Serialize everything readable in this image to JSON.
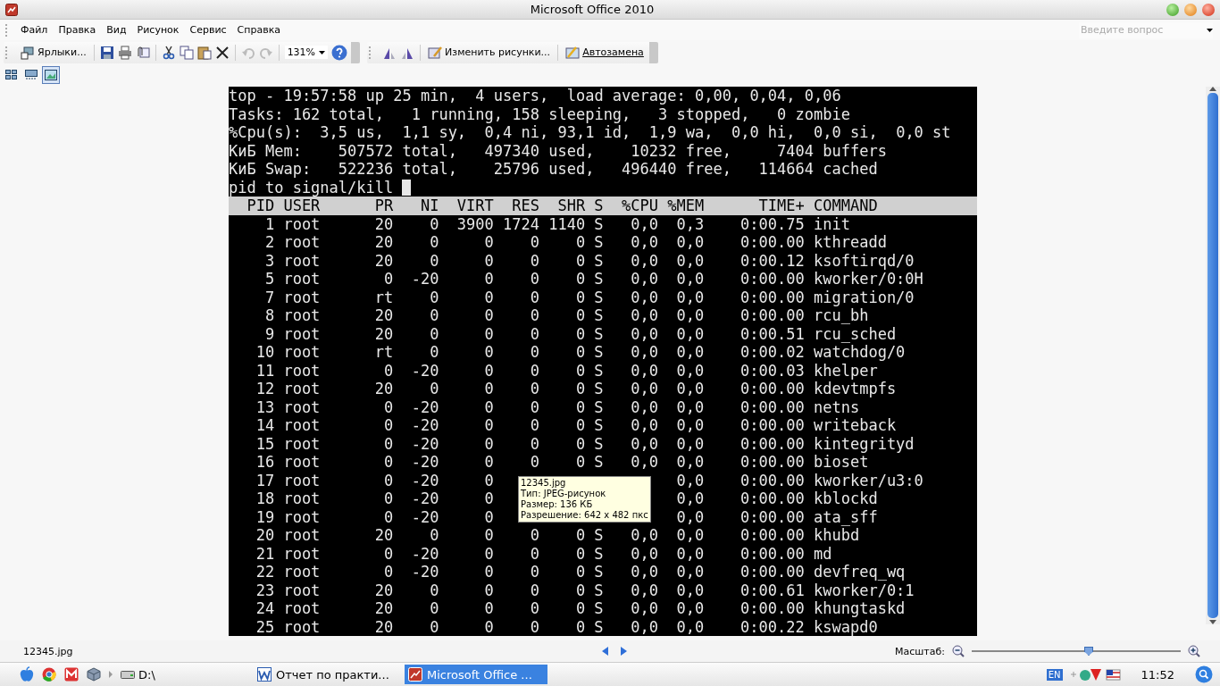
{
  "window": {
    "title": "Microsoft Office 2010"
  },
  "menu": [
    "Файл",
    "Правка",
    "Вид",
    "Рисунок",
    "Сервис",
    "Справка"
  ],
  "help_search": {
    "placeholder": "Введите вопрос"
  },
  "toolbar": {
    "shortcuts": "Ярлыки...",
    "zoom": "131%",
    "edit_pictures": "Изменить рисунки...",
    "autocorrect": "Автозамена"
  },
  "view_buttons": [
    {
      "kind": "thumbnails",
      "selected": false
    },
    {
      "kind": "filmstrip",
      "selected": false
    },
    {
      "kind": "single",
      "selected": true
    }
  ],
  "terminal": {
    "summary": [
      "top - 19:57:58 up 25 min,  4 users,  load average: 0,00, 0,04, 0,06",
      "Tasks: 162 total,   1 running, 158 sleeping,   3 stopped,   0 zombie",
      "%Cpu(s):  3,5 us,  1,1 sy,  0,4 ni, 93,1 id,  1,9 wa,  0,0 hi,  0,0 si,  0,0 st",
      "КиБ Mem:    507572 total,   497340 used,    10232 free,     7404 buffers",
      "КиБ Swap:   522236 total,    25796 used,   496440 free,   114664 cached"
    ],
    "prompt": "pid to signal/kill",
    "columns": {
      "pid": "PID",
      "user": "USER",
      "pr": "PR",
      "ni": "NI",
      "virt": "VIRT",
      "res": "RES",
      "shr": "SHR",
      "s": "S",
      "cpu": "%CPU",
      "mem": "%MEM",
      "time": "TIME+",
      "command": "COMMAND"
    },
    "rows": [
      {
        "pid": "1",
        "user": "root",
        "pr": "20",
        "ni": "0",
        "virt": "3900",
        "res": "1724",
        "shr": "1140",
        "s": "S",
        "cpu": "0,0",
        "mem": "0,3",
        "time": "0:00.75",
        "command": "init"
      },
      {
        "pid": "2",
        "user": "root",
        "pr": "20",
        "ni": "0",
        "virt": "0",
        "res": "0",
        "shr": "0",
        "s": "S",
        "cpu": "0,0",
        "mem": "0,0",
        "time": "0:00.00",
        "command": "kthreadd"
      },
      {
        "pid": "3",
        "user": "root",
        "pr": "20",
        "ni": "0",
        "virt": "0",
        "res": "0",
        "shr": "0",
        "s": "S",
        "cpu": "0,0",
        "mem": "0,0",
        "time": "0:00.12",
        "command": "ksoftirqd/0"
      },
      {
        "pid": "5",
        "user": "root",
        "pr": "0",
        "ni": "-20",
        "virt": "0",
        "res": "0",
        "shr": "0",
        "s": "S",
        "cpu": "0,0",
        "mem": "0,0",
        "time": "0:00.00",
        "command": "kworker/0:0H"
      },
      {
        "pid": "7",
        "user": "root",
        "pr": "rt",
        "ni": "0",
        "virt": "0",
        "res": "0",
        "shr": "0",
        "s": "S",
        "cpu": "0,0",
        "mem": "0,0",
        "time": "0:00.00",
        "command": "migration/0"
      },
      {
        "pid": "8",
        "user": "root",
        "pr": "20",
        "ni": "0",
        "virt": "0",
        "res": "0",
        "shr": "0",
        "s": "S",
        "cpu": "0,0",
        "mem": "0,0",
        "time": "0:00.00",
        "command": "rcu_bh"
      },
      {
        "pid": "9",
        "user": "root",
        "pr": "20",
        "ni": "0",
        "virt": "0",
        "res": "0",
        "shr": "0",
        "s": "S",
        "cpu": "0,0",
        "mem": "0,0",
        "time": "0:00.51",
        "command": "rcu_sched"
      },
      {
        "pid": "10",
        "user": "root",
        "pr": "rt",
        "ni": "0",
        "virt": "0",
        "res": "0",
        "shr": "0",
        "s": "S",
        "cpu": "0,0",
        "mem": "0,0",
        "time": "0:00.02",
        "command": "watchdog/0"
      },
      {
        "pid": "11",
        "user": "root",
        "pr": "0",
        "ni": "-20",
        "virt": "0",
        "res": "0",
        "shr": "0",
        "s": "S",
        "cpu": "0,0",
        "mem": "0,0",
        "time": "0:00.03",
        "command": "khelper"
      },
      {
        "pid": "12",
        "user": "root",
        "pr": "20",
        "ni": "0",
        "virt": "0",
        "res": "0",
        "shr": "0",
        "s": "S",
        "cpu": "0,0",
        "mem": "0,0",
        "time": "0:00.00",
        "command": "kdevtmpfs"
      },
      {
        "pid": "13",
        "user": "root",
        "pr": "0",
        "ni": "-20",
        "virt": "0",
        "res": "0",
        "shr": "0",
        "s": "S",
        "cpu": "0,0",
        "mem": "0,0",
        "time": "0:00.00",
        "command": "netns"
      },
      {
        "pid": "14",
        "user": "root",
        "pr": "0",
        "ni": "-20",
        "virt": "0",
        "res": "0",
        "shr": "0",
        "s": "S",
        "cpu": "0,0",
        "mem": "0,0",
        "time": "0:00.00",
        "command": "writeback"
      },
      {
        "pid": "15",
        "user": "root",
        "pr": "0",
        "ni": "-20",
        "virt": "0",
        "res": "0",
        "shr": "0",
        "s": "S",
        "cpu": "0,0",
        "mem": "0,0",
        "time": "0:00.00",
        "command": "kintegrityd"
      },
      {
        "pid": "16",
        "user": "root",
        "pr": "0",
        "ni": "-20",
        "virt": "0",
        "res": "0",
        "shr": "0",
        "s": "S",
        "cpu": "0,0",
        "mem": "0,0",
        "time": "0:00.00",
        "command": "bioset"
      },
      {
        "pid": "17",
        "user": "root",
        "pr": "0",
        "ni": "-20",
        "virt": "0",
        "mem": "0,0",
        "time": "0:00.00",
        "command": "kworker/u3:0"
      },
      {
        "pid": "18",
        "user": "root",
        "pr": "0",
        "ni": "-20",
        "virt": "0",
        "mem": "0,0",
        "time": "0:00.00",
        "command": "kblockd"
      },
      {
        "pid": "19",
        "user": "root",
        "pr": "0",
        "ni": "-20",
        "virt": "0",
        "mem": "0,0",
        "time": "0:00.00",
        "command": "ata_sff"
      },
      {
        "pid": "20",
        "user": "root",
        "pr": "20",
        "ni": "0",
        "virt": "0",
        "res": "0",
        "shr": "0",
        "s": "S",
        "cpu": "0,0",
        "mem": "0,0",
        "time": "0:00.00",
        "command": "khubd"
      },
      {
        "pid": "21",
        "user": "root",
        "pr": "0",
        "ni": "-20",
        "virt": "0",
        "res": "0",
        "shr": "0",
        "s": "S",
        "cpu": "0,0",
        "mem": "0,0",
        "time": "0:00.00",
        "command": "md"
      },
      {
        "pid": "22",
        "user": "root",
        "pr": "0",
        "ni": "-20",
        "virt": "0",
        "res": "0",
        "shr": "0",
        "s": "S",
        "cpu": "0,0",
        "mem": "0,0",
        "time": "0:00.00",
        "command": "devfreq_wq"
      },
      {
        "pid": "23",
        "user": "root",
        "pr": "20",
        "ni": "0",
        "virt": "0",
        "res": "0",
        "shr": "0",
        "s": "S",
        "cpu": "0,0",
        "mem": "0,0",
        "time": "0:00.61",
        "command": "kworker/0:1"
      },
      {
        "pid": "24",
        "user": "root",
        "pr": "20",
        "ni": "0",
        "virt": "0",
        "res": "0",
        "shr": "0",
        "s": "S",
        "cpu": "0,0",
        "mem": "0,0",
        "time": "0:00.00",
        "command": "khungtaskd"
      },
      {
        "pid": "25",
        "user": "root",
        "pr": "20",
        "ni": "0",
        "virt": "0",
        "res": "0",
        "shr": "0",
        "s": "S",
        "cpu": "0,0",
        "mem": "0,0",
        "time": "0:00.22",
        "command": "kswapd0"
      }
    ]
  },
  "tooltip": {
    "lines": [
      "12345.jpg",
      "Тип: JPEG-рисунок",
      "Размер: 136 КБ",
      "Разрешение: 642 x 482 пкс"
    ]
  },
  "status_bar": {
    "filename": "12345.jpg",
    "zoom_label": "Масштаб:",
    "zoom": {
      "level": 0.56
    }
  },
  "taskbar": {
    "drive": "D:\\",
    "tasks": [
      {
        "kind": "word",
        "label": "Отчет по практи...",
        "selected": false
      },
      {
        "kind": "picture-manager",
        "label": "Microsoft Office ...",
        "selected": true
      }
    ],
    "language": "EN",
    "clock": "11:52"
  }
}
